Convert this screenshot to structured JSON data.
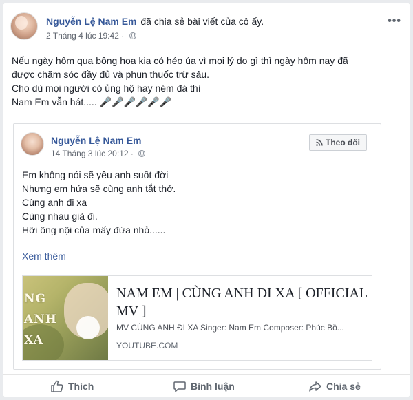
{
  "post": {
    "author": "Nguyễn Lệ Nam Em",
    "action_text": "đã chia sẻ bài viết của cô ấy.",
    "timestamp": "2 Tháng 4 lúc 19:42",
    "separator": "·",
    "more_label": "•••",
    "text_lines": [
      "Nếu ngày hôm qua bông hoa kia có héo úa vì mọi lý do gì thì ngày hôm nay đã",
      "được chăm sóc đầy đủ và phun thuốc trừ sâu.",
      "Cho dù mọi người có ủng hộ hay ném đá thì",
      "Nam Em vẫn hát..... 🎤🎤🎤🎤🎤🎤"
    ]
  },
  "shared": {
    "author": "Nguyễn Lệ Nam Em",
    "timestamp": "14 Tháng 3 lúc 20:12",
    "separator": "·",
    "follow_label": "Theo dõi",
    "text_lines": [
      "Em không nói sẽ yêu anh suốt đời",
      "Nhưng em hứa sẽ cùng anh tắt thở.",
      "Cùng anh đi xa",
      "Cùng nhau già đi.",
      "Hỡi ông nội của mấy đứa nhỏ......"
    ],
    "see_more": "Xem thêm",
    "link": {
      "title": "NAM EM | CÙNG ANH ĐI XA [ OFFICIAL MV ]",
      "description": "MV CÙNG ANH ĐI XA Singer: Nam Em Composer: Phúc Bồ...",
      "domain": "YOUTUBE.COM",
      "thumbnail_text": [
        "NG",
        "ANH",
        "XA"
      ]
    }
  },
  "actions": {
    "like": "Thích",
    "comment": "Bình luận",
    "share": "Chia sẻ"
  },
  "colors": {
    "link_blue": "#365899",
    "text": "#1d2129",
    "meta": "#616770",
    "background": "#e9ebee"
  }
}
